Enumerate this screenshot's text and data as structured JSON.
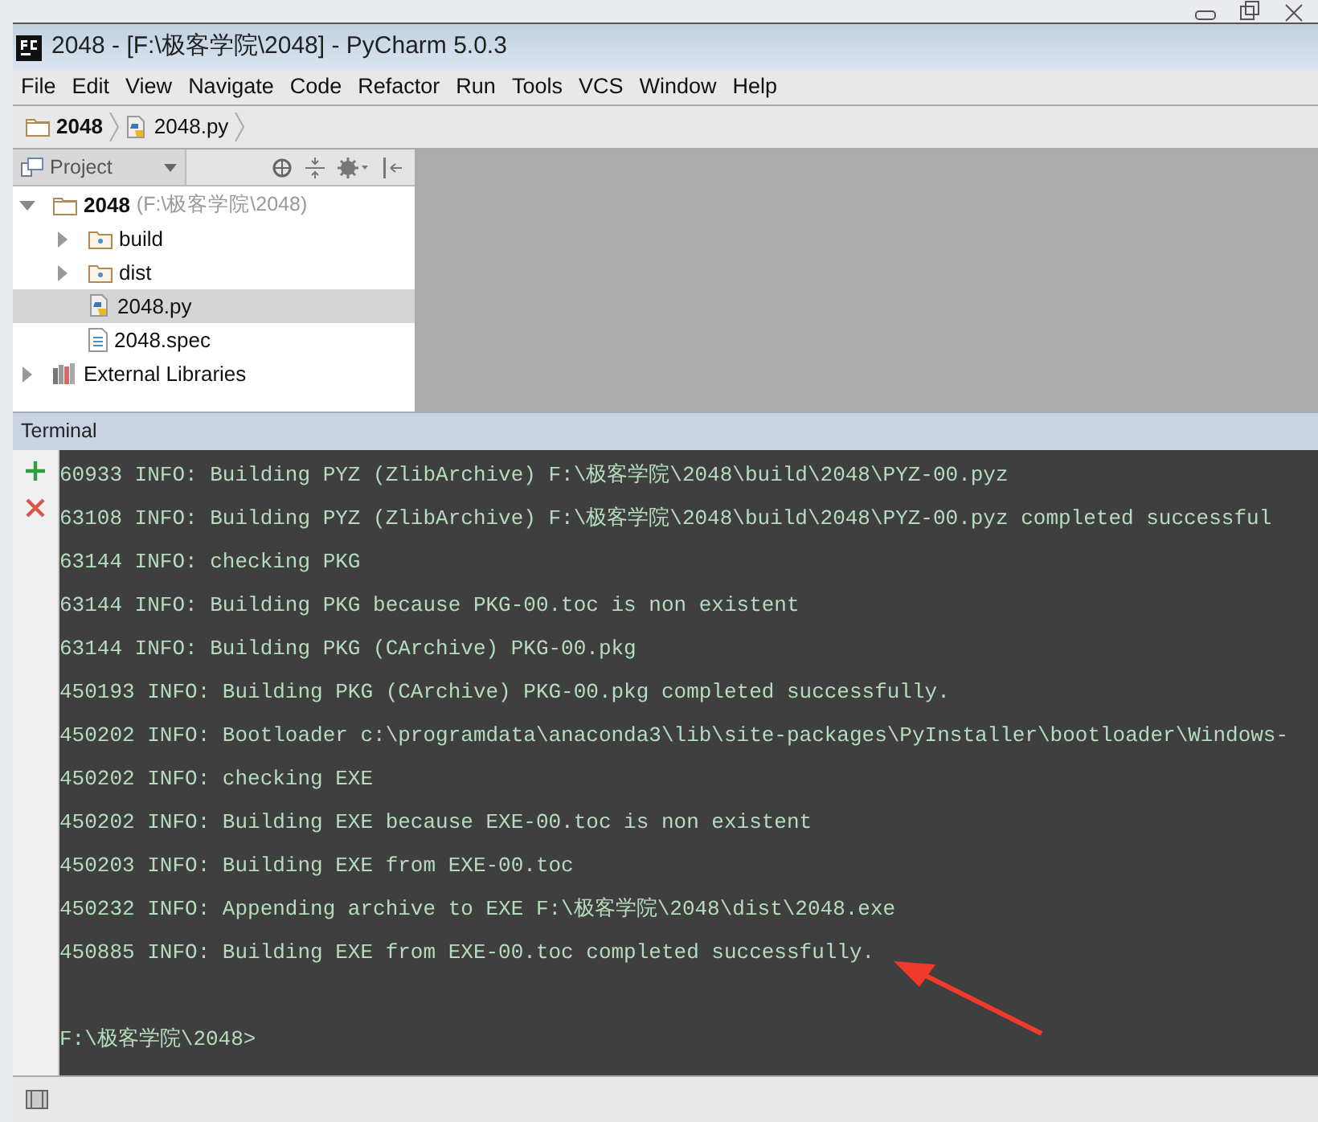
{
  "window": {
    "title": "2048 - [F:\\极客学院\\2048] - PyCharm 5.0.3"
  },
  "menu": [
    {
      "label": "File"
    },
    {
      "label": "Edit"
    },
    {
      "label": "View"
    },
    {
      "label": "Navigate"
    },
    {
      "label": "Code"
    },
    {
      "label": "Refactor"
    },
    {
      "label": "Run"
    },
    {
      "label": "Tools"
    },
    {
      "label": "VCS"
    },
    {
      "label": "Window"
    },
    {
      "label": "Help"
    }
  ],
  "breadcrumbs": [
    {
      "label": "2048",
      "kind": "folder"
    },
    {
      "label": "2048.py",
      "kind": "python"
    }
  ],
  "project_panel": {
    "title": "Project",
    "tree": [
      {
        "label": "2048",
        "detail": "(F:\\极客学院\\2048)",
        "kind": "folder",
        "expanded": true,
        "selected": false,
        "children": [
          {
            "label": "build",
            "kind": "folder",
            "expanded": false,
            "selected": false
          },
          {
            "label": "dist",
            "kind": "folder",
            "expanded": false,
            "selected": false
          },
          {
            "label": "2048.py",
            "kind": "python",
            "selected": true
          },
          {
            "label": "2048.spec",
            "kind": "text",
            "selected": false
          }
        ]
      },
      {
        "label": "External Libraries",
        "kind": "library",
        "expanded": false,
        "selected": false
      }
    ]
  },
  "terminal": {
    "title": "Terminal",
    "lines": [
      {
        "text": "60933 INFO: Building PYZ (ZlibArchive) F:\\极客学院\\2048\\build\\2048\\PYZ-00.pyz"
      },
      {
        "text": "63108 INFO: Building PYZ (ZlibArchive) F:\\极客学院\\2048\\build\\2048\\PYZ-00.pyz completed successful"
      },
      {
        "text": "63144 INFO: checking PKG"
      },
      {
        "text": "63144 INFO: Building PKG because PKG-00.toc is non existent"
      },
      {
        "text": "63144 INFO: Building PKG (CArchive) PKG-00.pkg"
      },
      {
        "text": "450193 INFO: Building PKG (CArchive) PKG-00.pkg completed successfully."
      },
      {
        "text": "450202 INFO: Bootloader c:\\programdata\\anaconda3\\lib\\site-packages\\PyInstaller\\bootloader\\Windows-"
      },
      {
        "text": "450202 INFO: checking EXE"
      },
      {
        "text": "450202 INFO: Building EXE because EXE-00.toc is non existent"
      },
      {
        "text": "450203 INFO: Building EXE from EXE-00.toc"
      },
      {
        "text": "450232 INFO: Appending archive to EXE F:\\极客学院\\2048\\dist\\2048.exe"
      },
      {
        "text": "450885 INFO: Building EXE from EXE-00.toc completed successfully."
      },
      {
        "text": "F:\\极客学院\\2048>",
        "kind": "prompt"
      }
    ]
  }
}
